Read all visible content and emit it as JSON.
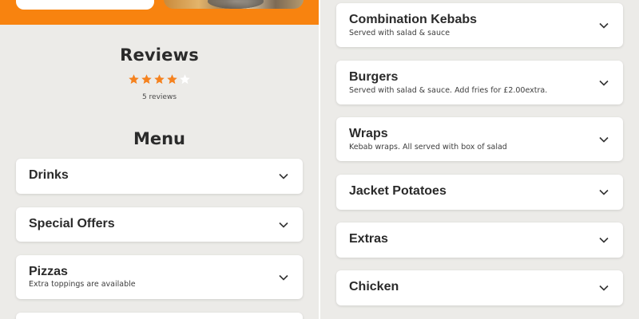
{
  "left": {
    "reviews_title": "Reviews",
    "rating": {
      "filled": 4,
      "total": 5
    },
    "reviews_count": "5 reviews",
    "menu_title": "Menu",
    "categories": [
      {
        "title": "Drinks",
        "subtitle": ""
      },
      {
        "title": "Special Offers",
        "subtitle": ""
      },
      {
        "title": "Pizzas",
        "subtitle": "Extra toppings are available"
      }
    ]
  },
  "right": {
    "categories": [
      {
        "title": "Combination Kebabs",
        "subtitle": "Served with salad & sauce"
      },
      {
        "title": "Burgers",
        "subtitle": "Served with salad & sauce. Add fries for £2.00extra."
      },
      {
        "title": "Wraps",
        "subtitle": "Kebab wraps. All served with box of salad"
      },
      {
        "title": "Jacket Potatoes",
        "subtitle": ""
      },
      {
        "title": "Extras",
        "subtitle": ""
      },
      {
        "title": "Chicken",
        "subtitle": ""
      }
    ]
  },
  "colors": {
    "brand_orange": "#f8830f",
    "star_filled": "#f5821f",
    "star_empty": "#ffffff",
    "background": "#ecebe8",
    "card": "#ffffff"
  },
  "icons": {
    "star": "star-icon",
    "expand": "chevron-down-icon"
  }
}
